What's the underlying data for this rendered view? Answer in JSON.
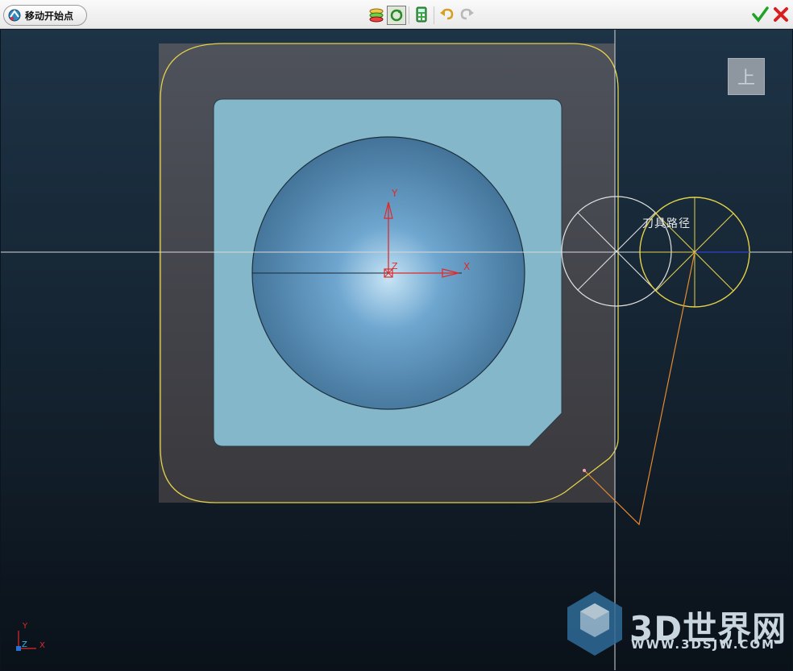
{
  "toolbar": {
    "start_button_label": "移动开始点",
    "icons": [
      "toolpath-icon",
      "select-rotate-icon",
      "calculator-icon",
      "undo-icon",
      "redo-icon",
      "ok-check-icon",
      "cancel-x-icon"
    ]
  },
  "viewport": {
    "view_cube_label": "上",
    "tool_path_label": "刀具路径",
    "axis_y_label": "Y",
    "axis_x_label": "X",
    "axis_z_label": "Z",
    "triad_y_label": "Y",
    "triad_z_label": "Z",
    "triad_x_label": "X"
  },
  "watermark": {
    "brand": "3D世界网",
    "url": "WWW.3DSJW.COM"
  },
  "colors": {
    "stock": "#454851",
    "pocket_floor": "#84b7c9",
    "sphere": "#4f86b3",
    "toolpath": "#e4d24a",
    "axis": "#e02a2a",
    "lead_line": "#e58a2e"
  }
}
